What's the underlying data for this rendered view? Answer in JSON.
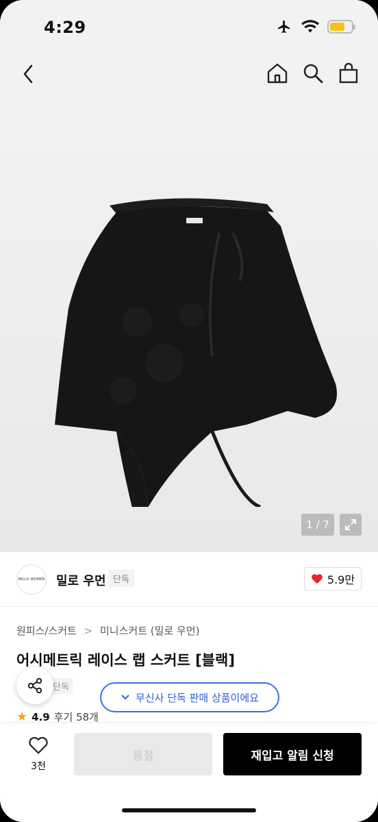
{
  "status_bar": {
    "time": "4:29"
  },
  "nav": {
    "icons": [
      "back-icon",
      "home-icon",
      "search-icon",
      "bag-icon"
    ]
  },
  "gallery": {
    "counter": "1 / 7"
  },
  "brand": {
    "logo_text": "MILLO WOMEN",
    "name": "밀로 우먼",
    "tag": "단독",
    "likes": "5.9만"
  },
  "product": {
    "breadcrumb": [
      "원피스/스커트",
      "미니스커트 (밀로 우먼)"
    ],
    "title": "어시메트릭 레이스 랩 스커트 [블랙]",
    "badge": "단독",
    "notice": "무신사 단독 판매 상품이에요",
    "rating": "4.9",
    "reviews": "후기 58개"
  },
  "bottom_bar": {
    "wish_count": "3천",
    "soldout_label": "품절",
    "restock_label": "재입고 알림 신청"
  },
  "colors": {
    "accent_blue": "#2b5fd9",
    "heart_red": "#e52528",
    "star": "#f5a623"
  }
}
